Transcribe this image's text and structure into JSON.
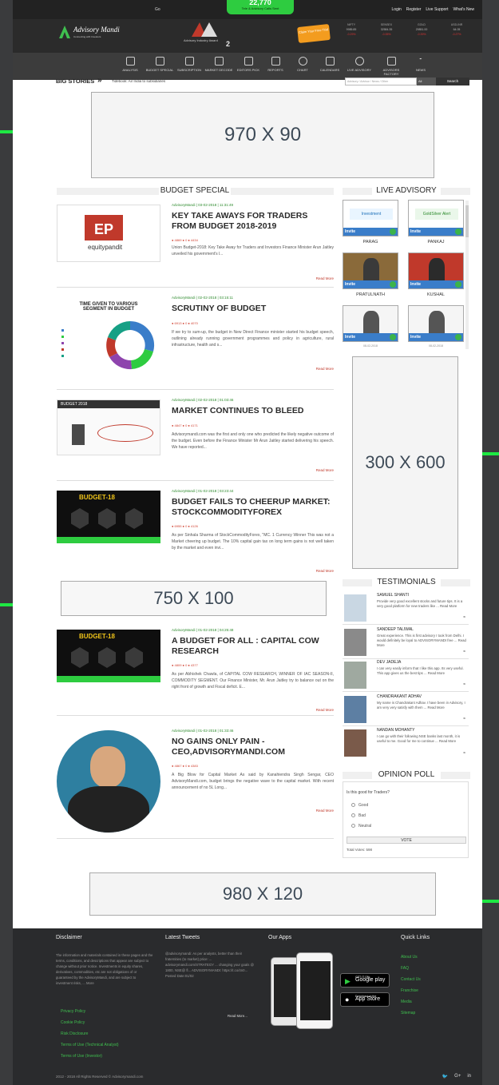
{
  "topbar": {
    "language": "Go",
    "links": [
      "Login",
      "Register",
      "Live Support",
      "What's New"
    ]
  },
  "header": {
    "logo_text": "Advisory Mandi",
    "logo_tagline": "Connecting with Investors",
    "ticker_number": "22,770",
    "ticker_sub": "Tele & Advisory Calls Sent",
    "award_line": "Advisory Industry Award",
    "award_number": "2",
    "claim": "Claim Your Free Trial",
    "quotes": [
      {
        "name": "NIFTY",
        "value": "9985.85",
        "change": "-0.29%"
      },
      {
        "name": "SENSEX",
        "value": "32584.35",
        "change": "-0.35%"
      },
      {
        "name": "GOLD",
        "value": "29851.00",
        "change": "-0.39%"
      },
      {
        "name": "USD-INR",
        "value": "64.05",
        "change": "-0.27%"
      }
    ]
  },
  "nav": [
    "ANALYSIS",
    "BUDGET SPECIAL",
    "SUBSCRIPTION",
    "MARKET DECODE",
    "EDITORS PICK",
    "REPORTS",
    "CHART",
    "CALENDARS",
    "LIVE ADVISORY",
    "ADVISORS FACTORY",
    "NEWS"
  ],
  "bigstories": {
    "title": "BIG STORIES",
    "text": "Tidebook: Air India to subsidiaries",
    "search_placeholder": "Advisory / Advisor / News / Other",
    "select": "All",
    "button": "Search"
  },
  "ads": {
    "top": "970 X 90",
    "mid": "750 X 100",
    "side": "300 X 600",
    "bottom": "980 X 120"
  },
  "budget_special": {
    "heading": "BUDGET SPECIAL",
    "articles": [
      {
        "meta": "AdvisoryMandi | 03-02-2018 | 11:31:49",
        "title": "KEY TAKE AWAYS FOR TRADERS FROM BUDGET 2018-2019",
        "stats": "● 4869  ● 0  ● 4434",
        "body": "Union Budget-2018: Key Take Away for Traders and Investors Finance Minister Arun Jaitley unveiled his government's l...",
        "more": "Read More",
        "thumb_text": "equitypandit"
      },
      {
        "meta": "AdvisoryMandi | 02-02-2018 | 03:15:11",
        "title": "SCRUTINY OF BUDGET",
        "stats": "● 6913  ● 0  ● 4070",
        "body": "If we try to sum-up, the budget in New Direct Finance minister started his budget speech, outlining already running government programmes and policy in agriculture, rural infrastructure, health and s...",
        "more": "Read More",
        "thumb_text": "TIME GIVEN TO VARIOUS SEGMENT IN BUDGET"
      },
      {
        "meta": "AdvisoryMandi | 02-02-2018 | 01:03:46",
        "title": "MARKET CONTINUES TO BLEED",
        "stats": "● 4847  ● 0  ● 4171",
        "body": "Advisorymandi.com was the first and only one who predicted the likely negative outcome of the budget. Even before the Finance Minister Mr Arun Jaitley started delivering his speech. We have reported...",
        "more": "Read More",
        "thumb_text": "BUDGET 2018"
      },
      {
        "meta": "AdvisoryMandi | 01-02-2018 | 03:23:44",
        "title": "BUDGET FAILS TO CHEERUP MARKET: STOCKCOMMODITYFOREX",
        "stats": "● 6955  ● 0  ● 4126",
        "body": "As per Sinhala Sharma of StockCommodityForex, \"MC. 1 Currency Winner This was not a Market cheering up budget. The 10% capital gain tax on long term gains is not well taken by the market and even invi...",
        "more": "Read More",
        "thumb_text": "BUDGET-18"
      },
      {
        "meta": "AdvisoryMandi | 01-02-2018 | 04:25:48",
        "title": "A BUDGET FOR ALL : CAPITAL COW RESEARCH",
        "stats": "● 4809  ● 0  ● 4377",
        "body": "As per Abhishek Chawla, of CAPITAL COW RESEARCH, WINNER OF IAC SEASON-II, COMMODITY SEGMENT. Our Finance Minister, Mr. Arun Jaitley try to balance out on the right front of growth and Fiscal deficit. E...",
        "more": "Read More",
        "thumb_text": "BUDGET-18"
      },
      {
        "meta": "AdvisoryMandi | 01-02-2018 | 01:33:46",
        "title": "NO GAINS ONLY PAIN -CEO,ADVISORYMANDI.COM",
        "stats": "● 4867  ● 0  ● 4383",
        "body": "A Big Blow for Capital Market As said by Kanahiendra Singh Sengar, CEO AdvisoryMandi.com, budget brings the negative wave to the capital market. With recent announcement of no 5L Long...",
        "more": "Read More",
        "thumb_text": ""
      }
    ]
  },
  "live_advisory": {
    "heading": "LIVE ADVISORY",
    "cards": [
      {
        "name": "PARAG",
        "invite": "Invite"
      },
      {
        "name": "PANKAJ",
        "invite": "Invite"
      },
      {
        "name": "PRATULNATH",
        "invite": "Invite"
      },
      {
        "name": "KUSHAL",
        "invite": "Invite"
      },
      {
        "name": "",
        "invite": "Invite"
      },
      {
        "name": "",
        "invite": "Invite"
      }
    ],
    "bottom_labels": [
      "08-02-2018",
      "08-02-2018"
    ]
  },
  "testimonials": {
    "heading": "TESTIMONIALS",
    "items": [
      {
        "name": "SAMUEL SHANTI",
        "text": "Provide very good excellent stocks and future tips. It is a very good platform for new traders like ... Read More"
      },
      {
        "name": "SANDEEP TALIWAL",
        "text": "Great experience. This is first advisory I took from Delhi. I would definitely be loyal to ADVISORYMANDI free ... Read More"
      },
      {
        "name": "DEV JADEJA",
        "text": "I can very easily inform that I like this app. Its very useful. This app gives us the best tips ... Read More"
      },
      {
        "name": "CHANDRAKANT ADHAV",
        "text": "My name is Chandrakant Adhav. I have been in Advisory, I am very very satisfy with them ... Read More"
      },
      {
        "name": "NANDAN MOHANTY",
        "text": "I can go with their following NSE banks last month, it is useful to me. Good for me to continue ... Read More"
      }
    ]
  },
  "poll": {
    "heading": "OPINION POLL",
    "question": "Is this good for Traders?",
    "options": [
      "Good",
      "Bad",
      "Neutral"
    ],
    "vote": "VOTE",
    "total": "Total Votes: 598"
  },
  "footer": {
    "disclaimer_head": "Disclaimer",
    "disclaimer_text": "The information and materials contained in these pages and the terms, conditions, and descriptions that appear are subject to change without prior notice. Investments in equity shares, derivatives, commodities, etc are not obligations of or guaranteed by the AdvisoryMandi, and are subject to investment risks, ... More",
    "disclaimer_links": [
      "Privacy Policy",
      "Cookie Policy",
      "Risk Disclosure",
      "Terms of Use (Technical Analyst)",
      "Terms of Use (Investor)"
    ],
    "tweets_head": "Latest Tweets",
    "tweets_text": "@advisorymandi: As per analysts, better than their fraternities (to market) price: ... advisorymandi.com/STRATEGY ... changing your goals @ 1800, NSE@ fl... ADVISORYMANDI: https://t.co/4n0... Posted Date:01/02",
    "tweets_more": "Read More...",
    "apps_head": "Our Apps",
    "store1_small": "GET IT ON",
    "store1": "Google play",
    "store2_small": "Download on the",
    "store2": "App Store",
    "ql_head": "Quick Links",
    "ql_links": [
      "About Us",
      "FAQ",
      "Contact Us",
      "Franchise",
      "Media",
      "Sitemap"
    ],
    "copyright": "2012 - 2018 All Rights Reserved © Advisorymandi.com"
  }
}
